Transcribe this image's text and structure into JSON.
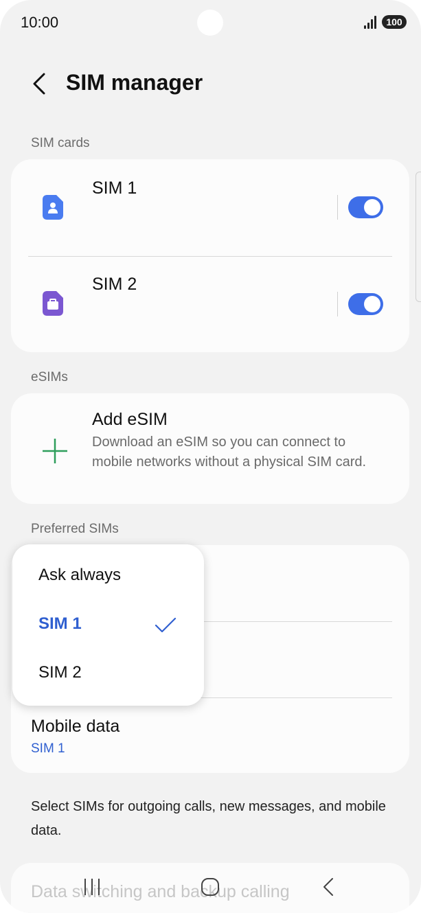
{
  "status_bar": {
    "time": "10:00",
    "battery": "100"
  },
  "header": {
    "title": "SIM manager"
  },
  "sim_cards": {
    "section_title": "SIM cards",
    "items": [
      {
        "label": "SIM 1",
        "enabled": true,
        "icon": "person-icon",
        "icon_color": "#4a7cf0"
      },
      {
        "label": "SIM 2",
        "enabled": true,
        "icon": "briefcase-icon",
        "icon_color": "#7b57d1"
      }
    ]
  },
  "esims": {
    "section_title": "eSIMs",
    "add": {
      "title": "Add eSIM",
      "description": "Download an eSIM so you can connect to mobile networks without a physical SIM card."
    }
  },
  "preferred": {
    "section_title": "Preferred SIMs",
    "mobile_data": {
      "title": "Mobile data",
      "value": "SIM 1"
    }
  },
  "dropdown": {
    "options": [
      "Ask always",
      "SIM 1",
      "SIM 2"
    ],
    "selected": "SIM 1"
  },
  "footnote": "Select SIMs for outgoing calls, new messages, and mobile data.",
  "next_item": {
    "label": "Data switching and backup calling"
  },
  "colors": {
    "accent": "#3e6ee8",
    "selected_text": "#2f5fd0",
    "add_icon": "#2e9e5b"
  }
}
